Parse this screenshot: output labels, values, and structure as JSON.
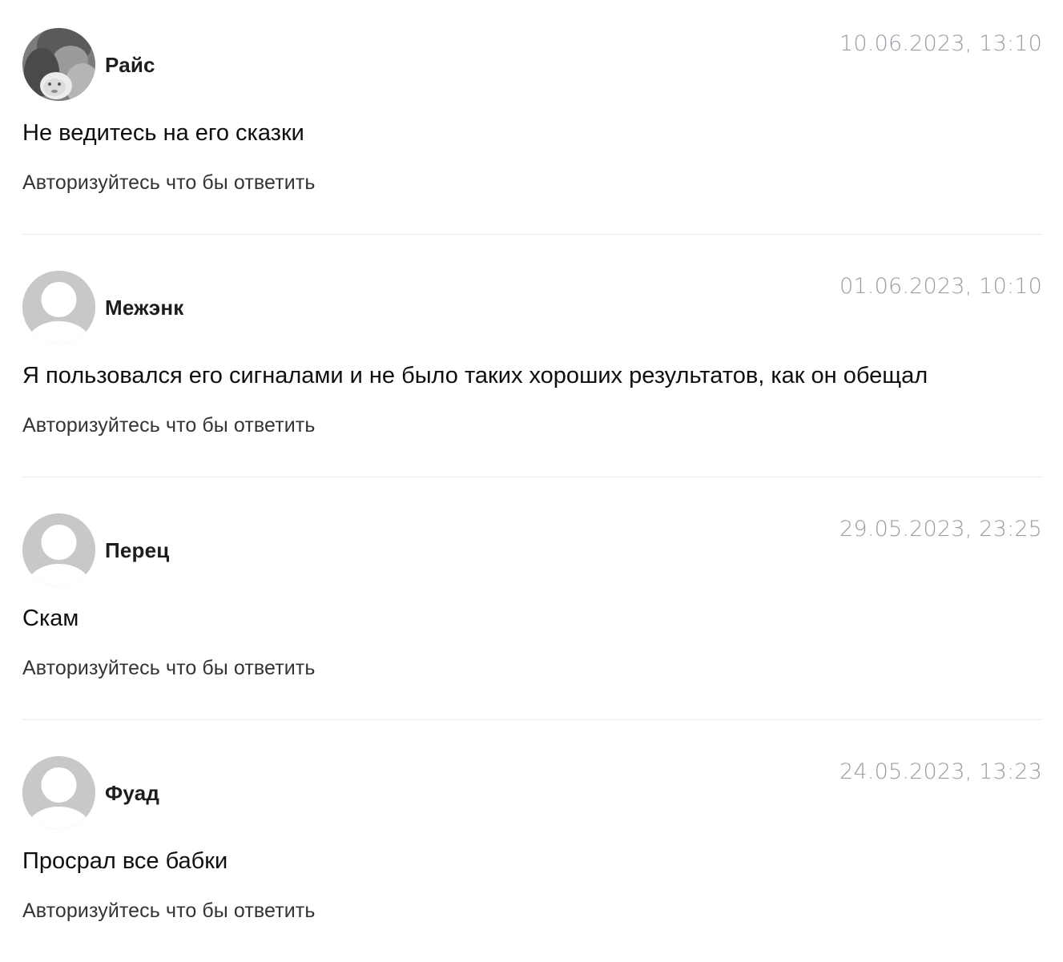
{
  "comments": [
    {
      "author": "Райс",
      "date": "10.06.2023, 13:10",
      "text": "Не ведитесь на его сказки",
      "reply_label": "Авторизуйтесь что бы ответить",
      "avatar": "photo-avatar"
    },
    {
      "author": "Межэнк",
      "date": "01.06.2023, 10:10",
      "text": "Я пользовался его сигналами и не было таких хороших результатов, как он обещал",
      "reply_label": "Авторизуйтесь что бы ответить",
      "avatar": "default-user-icon"
    },
    {
      "author": "Перец",
      "date": "29.05.2023, 23:25",
      "text": "Скам",
      "reply_label": "Авторизуйтесь что бы ответить",
      "avatar": "default-user-icon"
    },
    {
      "author": "Фуад",
      "date": "24.05.2023, 13:23",
      "text": "Просрал все бабки",
      "reply_label": "Авторизуйтесь что бы ответить",
      "avatar": "default-user-icon"
    }
  ],
  "colors": {
    "date": "#9a9ca6",
    "avatar_placeholder": "#c8c8c8",
    "divider": "#ececec"
  }
}
